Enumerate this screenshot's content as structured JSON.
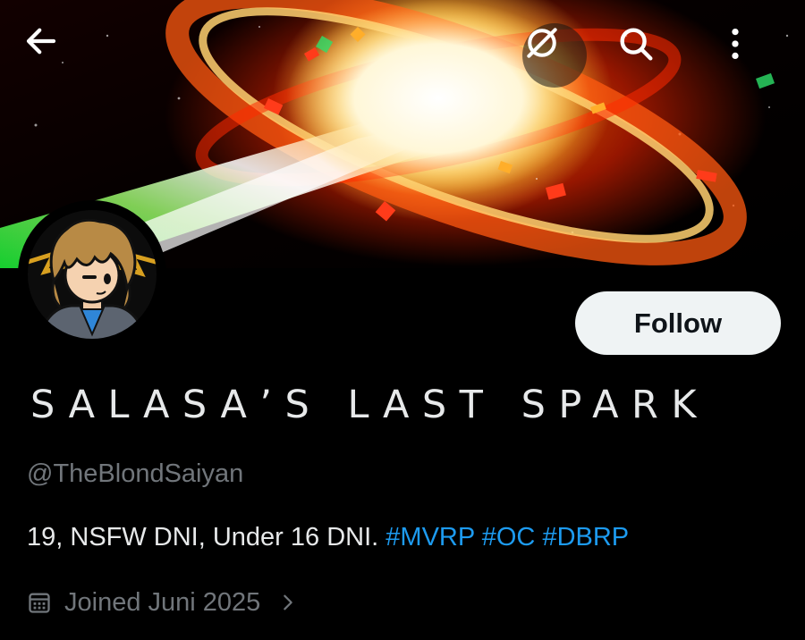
{
  "header": {
    "back_icon": "arrow-left-icon",
    "grok_icon": "grok-slash-circle-icon",
    "search_icon": "search-icon",
    "more_icon": "more-vertical-icon"
  },
  "profile": {
    "display_name": "SALASA’S LAST SPARK",
    "handle": "@TheBlondSaiyan",
    "bio_text": "19, NSFW DNI, Under 16 DNI. ",
    "hashtags": [
      "#MVRP",
      "#OC",
      "#DBRP"
    ],
    "joined": "Joined Juni 2025",
    "follow_label": "Follow"
  },
  "colors": {
    "background": "#000000",
    "text": "#e7e9ea",
    "secondary": "#71767b",
    "link": "#1d9bf0",
    "button_bg": "#eff3f4"
  }
}
